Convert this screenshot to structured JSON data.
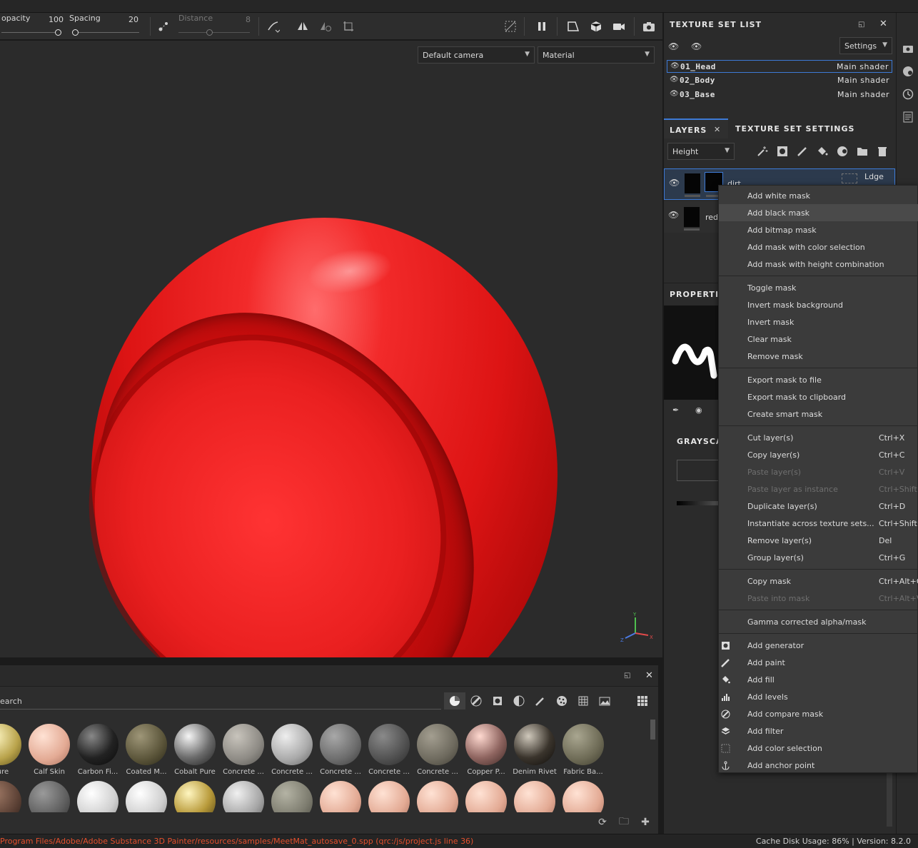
{
  "toolbar": {
    "opacity_label": "opacity",
    "opacity_value": "100",
    "opacity_level": 1.0,
    "spacing_label": "Spacing",
    "spacing_value": "20",
    "distance_label": "Distance",
    "distance_value": "8",
    "icons": [
      "brush-settings-icon",
      "lazy-mouse-icon",
      "symmetry-icon",
      "symmetry-options-icon",
      "transform-icon",
      "hide-unselected-icon",
      "pause-icon",
      "camera-mode-icon",
      "cube-icon",
      "camera-icon",
      "screenshot-icon"
    ]
  },
  "viewport": {
    "camera_dropdown": "Default camera",
    "mode_dropdown": "Material",
    "gizmo_labels": {
      "y": "Y",
      "x": "X",
      "z": "Z"
    }
  },
  "shelf": {
    "search_placeholder": "earch",
    "materials_row1": [
      "Pure",
      "Calf Skin",
      "Carbon Fi...",
      "Coated M...",
      "Cobalt Pure",
      "Concrete ...",
      "Concrete ...",
      "Concrete ...",
      "Concrete ...",
      "Concrete ...",
      "Copper P...",
      "Denim Rivet",
      "Fabric Ba..."
    ]
  },
  "statusbar": {
    "error": "Program Files/Adobe/Adobe Substance 3D Painter/resources/samples/MeetMat_autosave_0.spp (qrc:/js/project.js line 36)",
    "right": "Cache Disk Usage:   86%  |  Version: 8.2.0"
  },
  "texture_set_list": {
    "title": "TEXTURE SET LIST",
    "settings": "Settings",
    "rows": [
      {
        "name": "01_Head",
        "shader": "Main shader"
      },
      {
        "name": "02_Body",
        "shader": "Main shader"
      },
      {
        "name": "03_Base",
        "shader": "Main shader"
      }
    ]
  },
  "layers": {
    "tab_layers": "LAYERS",
    "tab_settings": "TEXTURE SET SETTINGS",
    "channel_dropdown": "Height",
    "layer1_name": "dirt",
    "layer1_blend": "Ldge",
    "layer2_name": "red",
    "properties_title": "PROPERTIE",
    "grayscale_title": "GRAYSCA"
  },
  "context_menu": {
    "items": [
      {
        "label": "Add white mask",
        "shortcut": "",
        "disabled": false,
        "highlight": false
      },
      {
        "label": "Add black mask",
        "shortcut": "",
        "disabled": false,
        "highlight": true
      },
      {
        "label": "Add bitmap mask",
        "shortcut": "",
        "disabled": false,
        "highlight": false
      },
      {
        "label": "Add mask with color selection",
        "shortcut": "",
        "disabled": false,
        "highlight": false
      },
      {
        "label": "Add mask with height combination",
        "shortcut": "",
        "disabled": false,
        "highlight": false
      },
      {
        "label": "Toggle mask",
        "shortcut": "",
        "disabled": false,
        "highlight": false
      },
      {
        "label": "Invert mask background",
        "shortcut": "",
        "disabled": false,
        "highlight": false
      },
      {
        "label": "Invert mask",
        "shortcut": "",
        "disabled": false,
        "highlight": false
      },
      {
        "label": "Clear mask",
        "shortcut": "",
        "disabled": false,
        "highlight": false
      },
      {
        "label": "Remove mask",
        "shortcut": "",
        "disabled": false,
        "highlight": false
      },
      {
        "label": "Export mask to file",
        "shortcut": "",
        "disabled": false,
        "highlight": false
      },
      {
        "label": "Export mask to clipboard",
        "shortcut": "",
        "disabled": false,
        "highlight": false
      },
      {
        "label": "Create smart mask",
        "shortcut": "",
        "disabled": false,
        "highlight": false
      },
      {
        "label": "Cut layer(s)",
        "shortcut": "Ctrl+X",
        "disabled": false,
        "highlight": false
      },
      {
        "label": "Copy layer(s)",
        "shortcut": "Ctrl+C",
        "disabled": false,
        "highlight": false
      },
      {
        "label": "Paste layer(s)",
        "shortcut": "Ctrl+V",
        "disabled": true,
        "highlight": false
      },
      {
        "label": "Paste layer as instance",
        "shortcut": "Ctrl+Shift+",
        "disabled": true,
        "highlight": false
      },
      {
        "label": "Duplicate layer(s)",
        "shortcut": "Ctrl+D",
        "disabled": false,
        "highlight": false
      },
      {
        "label": "Instantiate across texture sets...",
        "shortcut": "Ctrl+Shift+",
        "disabled": false,
        "highlight": false
      },
      {
        "label": "Remove layer(s)",
        "shortcut": "Del",
        "disabled": false,
        "highlight": false
      },
      {
        "label": "Group layer(s)",
        "shortcut": "Ctrl+G",
        "disabled": false,
        "highlight": false
      },
      {
        "label": "Copy mask",
        "shortcut": "Ctrl+Alt+C",
        "disabled": false,
        "highlight": false
      },
      {
        "label": "Paste into mask",
        "shortcut": "Ctrl+Alt+V",
        "disabled": true,
        "highlight": false
      },
      {
        "label": "Gamma corrected alpha/mask",
        "shortcut": "",
        "disabled": false,
        "highlight": false
      },
      {
        "label": "Add generator",
        "shortcut": "",
        "disabled": false,
        "highlight": false,
        "icon": "generator-icon"
      },
      {
        "label": "Add paint",
        "shortcut": "",
        "disabled": false,
        "highlight": false,
        "icon": "paint-brush-icon"
      },
      {
        "label": "Add fill",
        "shortcut": "",
        "disabled": false,
        "highlight": false,
        "icon": "fill-bucket-icon"
      },
      {
        "label": "Add levels",
        "shortcut": "",
        "disabled": false,
        "highlight": false,
        "icon": "levels-icon"
      },
      {
        "label": "Add compare mask",
        "shortcut": "",
        "disabled": false,
        "highlight": false,
        "icon": "compare-mask-icon"
      },
      {
        "label": "Add filter",
        "shortcut": "",
        "disabled": false,
        "highlight": false,
        "icon": "filter-icon"
      },
      {
        "label": "Add color selection",
        "shortcut": "",
        "disabled": false,
        "highlight": false,
        "icon": "color-selection-icon"
      },
      {
        "label": "Add anchor point",
        "shortcut": "",
        "disabled": false,
        "highlight": false,
        "icon": "anchor-icon"
      }
    ]
  }
}
